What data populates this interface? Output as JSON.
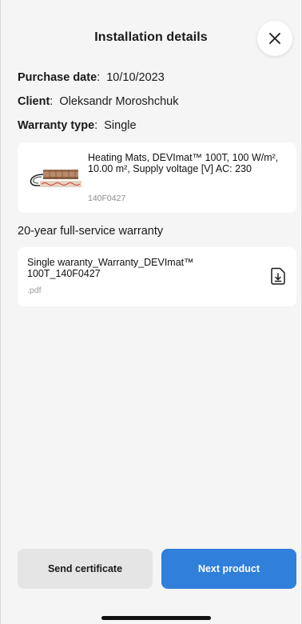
{
  "header": {
    "title": "Installation details",
    "close_icon": "close-icon"
  },
  "details": {
    "purchase_date_label": "Purchase date",
    "purchase_date_value": "10/10/2023",
    "client_label": "Client",
    "client_value": "Oleksandr Moroshchuk",
    "warranty_type_label": "Warranty type",
    "warranty_type_value": "Single"
  },
  "product": {
    "name": "Heating Mats, DEVImat™ 100T, 100 W/m², 10.00 m², Supply voltage [V] AC: 230",
    "code": "140F0427",
    "image_icon": "heating-mat-image"
  },
  "warranty": {
    "heading": "20-year full-service warranty",
    "document": {
      "name": "Single waranty_Warranty_DEVImat™ 100T_140F0427",
      "extension": ".pdf",
      "icon": "download-icon"
    }
  },
  "actions": {
    "send_certificate": "Send certificate",
    "next_product": "Next product"
  },
  "colors": {
    "background": "#f5f5f5",
    "card": "#ffffff",
    "primary": "#2f7fdb",
    "secondary": "#e5e5e5"
  }
}
